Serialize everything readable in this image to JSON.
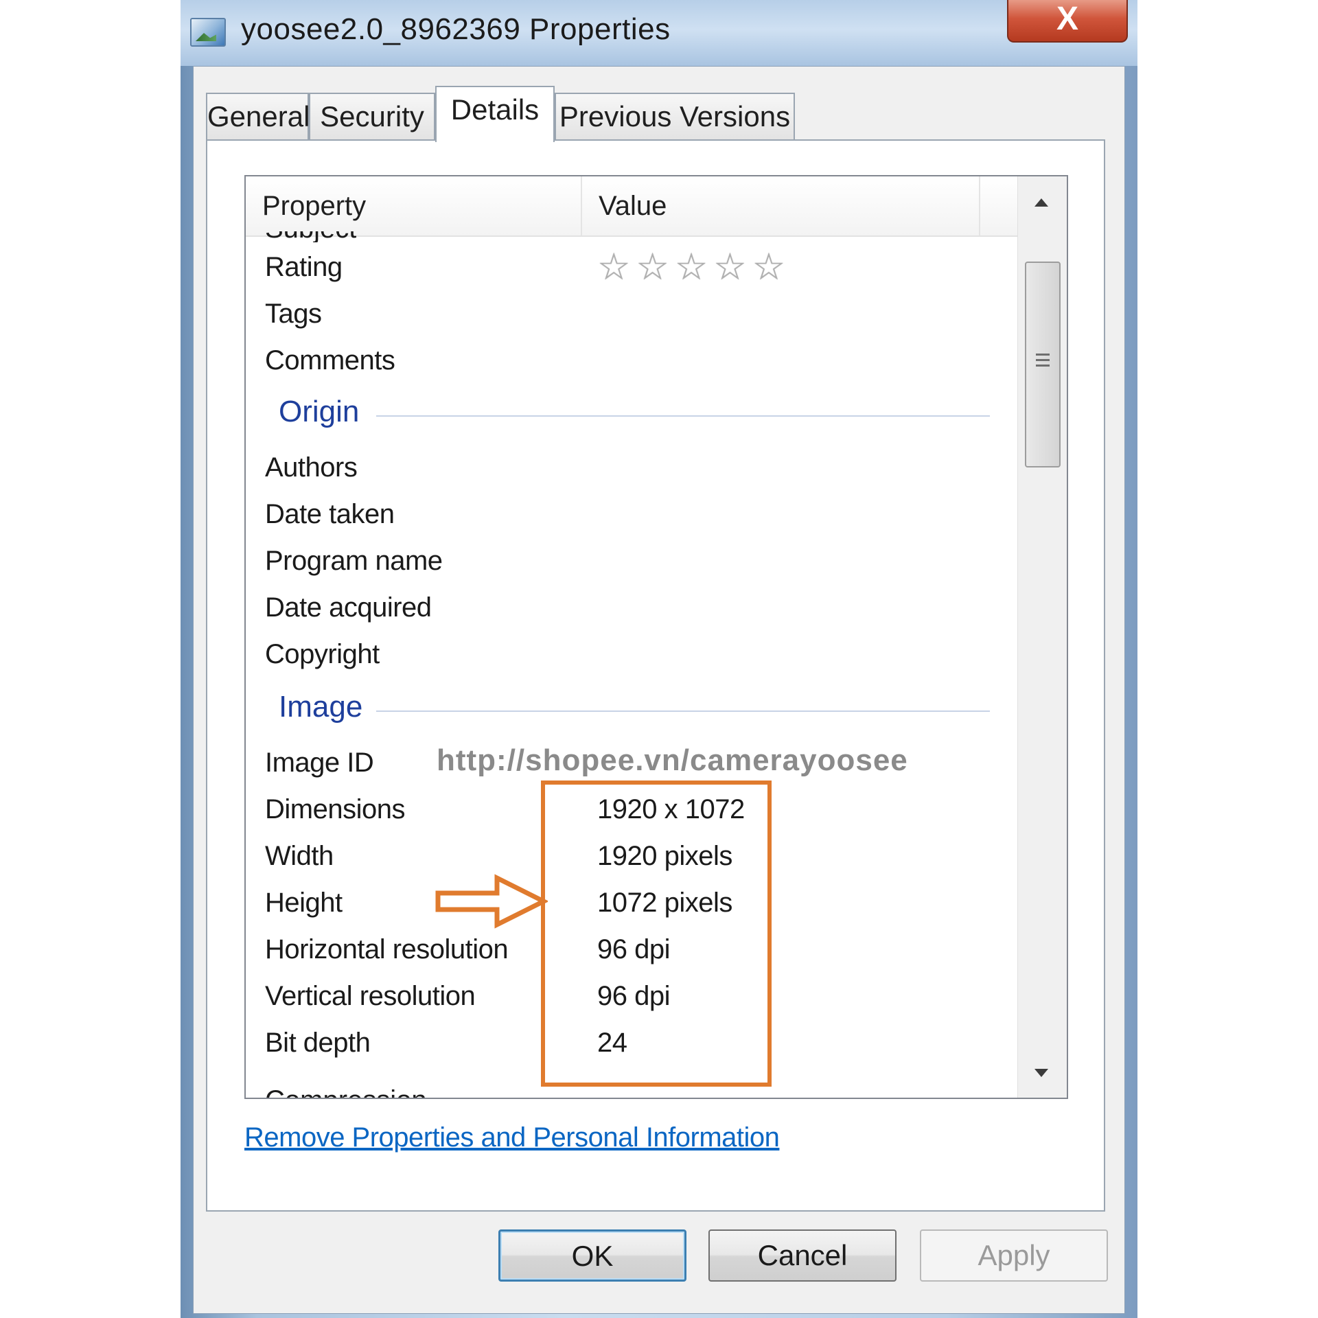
{
  "window": {
    "title": "yoosee2.0_8962369 Properties",
    "close_label": "X"
  },
  "tabs": [
    {
      "label": "General"
    },
    {
      "label": "Security"
    },
    {
      "label": "Details"
    },
    {
      "label": "Previous Versions"
    }
  ],
  "active_tab": "Details",
  "columns": {
    "property": "Property",
    "value": "Value"
  },
  "partial_top_row": "Subject",
  "rows_description": [
    {
      "property": "Rating",
      "value": "",
      "rating_stars": 0,
      "rating_max": 5
    },
    {
      "property": "Tags",
      "value": ""
    },
    {
      "property": "Comments",
      "value": ""
    }
  ],
  "groups": {
    "origin": "Origin",
    "image": "Image"
  },
  "rows_origin": [
    {
      "property": "Authors",
      "value": ""
    },
    {
      "property": "Date taken",
      "value": ""
    },
    {
      "property": "Program name",
      "value": ""
    },
    {
      "property": "Date acquired",
      "value": ""
    },
    {
      "property": "Copyright",
      "value": ""
    }
  ],
  "rows_image": [
    {
      "property": "Image ID",
      "value": ""
    },
    {
      "property": "Dimensions",
      "value": "1920 x 1072"
    },
    {
      "property": "Width",
      "value": "1920 pixels"
    },
    {
      "property": "Height",
      "value": "1072 pixels"
    },
    {
      "property": "Horizontal resolution",
      "value": "96 dpi"
    },
    {
      "property": "Vertical resolution",
      "value": "96 dpi"
    },
    {
      "property": "Bit depth",
      "value": "24"
    }
  ],
  "partial_bottom_row": "Compression",
  "watermark": "http://shopee.vn/camerayoosee",
  "highlight_color": "#e07b2e",
  "link_text": "Remove Properties and Personal Information",
  "buttons": {
    "ok": "OK",
    "cancel": "Cancel",
    "apply": "Apply"
  },
  "icons": {
    "title": "image-file-icon",
    "close": "close-icon",
    "rating": "star-icon",
    "scroll_up": "scroll-up-arrow-icon",
    "scroll_down": "scroll-down-arrow-icon",
    "annotation": "right-arrow-icon"
  }
}
